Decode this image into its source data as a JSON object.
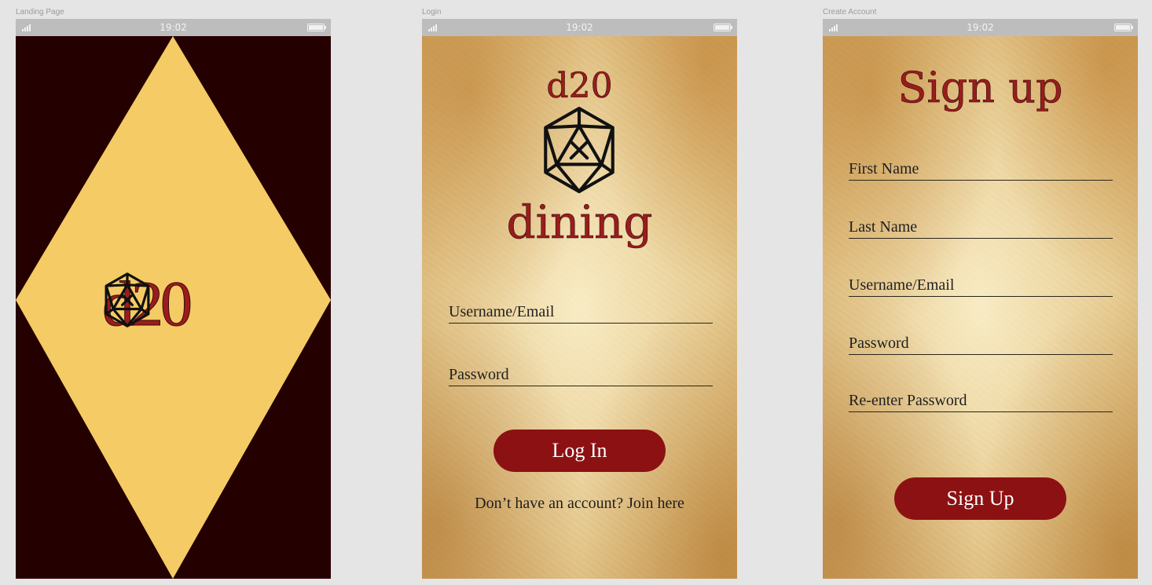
{
  "frames": [
    {
      "label": "Landing Page",
      "status_time": "19:02",
      "logo_text": "d20"
    },
    {
      "label": "Login",
      "status_time": "19:02",
      "logo_top": "d20",
      "logo_bottom": "dining",
      "fields": [
        "Username/Email",
        "Password"
      ],
      "button": "Log In",
      "footer_link": "Don’t have an account? Join here"
    },
    {
      "label": "Create Account",
      "status_time": "19:02",
      "title": "Sign up",
      "fields": [
        "First Name",
        "Last Name",
        "Username/Email",
        "Password",
        "Re-enter Password"
      ],
      "button": "Sign Up"
    }
  ],
  "colors": {
    "canvas_bg": "#e5e5e5",
    "landing_bg": "#240000",
    "diamond": "#f5cb65",
    "brand_red": "#9b1c1c",
    "button_red": "#8c1113",
    "parchment": "#ead39a"
  },
  "icons": [
    "signal-icon",
    "battery-icon",
    "d20-fork-knife-icon"
  ]
}
